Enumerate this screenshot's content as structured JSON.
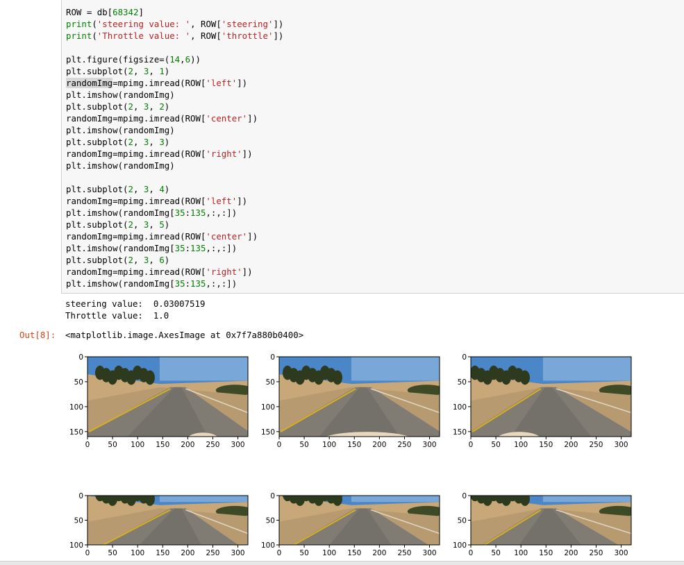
{
  "code_lines": [
    [
      {
        "t": "ROW = db["
      },
      {
        "t": "68342",
        "c": "num"
      },
      {
        "t": "]"
      }
    ],
    [
      {
        "t": "print",
        "c": "kw"
      },
      {
        "t": "("
      },
      {
        "t": "'steering value: '",
        "c": "str"
      },
      {
        "t": ", ROW["
      },
      {
        "t": "'steering'",
        "c": "str"
      },
      {
        "t": "])"
      }
    ],
    [
      {
        "t": "print",
        "c": "kw"
      },
      {
        "t": "("
      },
      {
        "t": "'Throttle value: '",
        "c": "str"
      },
      {
        "t": ", ROW["
      },
      {
        "t": "'throttle'",
        "c": "str"
      },
      {
        "t": "])"
      }
    ],
    [],
    [
      {
        "t": "plt.figure(figsize=("
      },
      {
        "t": "14",
        "c": "num"
      },
      {
        "t": ","
      },
      {
        "t": "6",
        "c": "num"
      },
      {
        "t": "))"
      }
    ],
    [
      {
        "t": "plt.subplot("
      },
      {
        "t": "2",
        "c": "num"
      },
      {
        "t": ", "
      },
      {
        "t": "3",
        "c": "num"
      },
      {
        "t": ", "
      },
      {
        "t": "1",
        "c": "num"
      },
      {
        "t": ")"
      }
    ],
    [
      {
        "t": "randomImg",
        "c": "hl"
      },
      {
        "t": "=mpimg.imread(ROW["
      },
      {
        "t": "'left'",
        "c": "str"
      },
      {
        "t": "])"
      }
    ],
    [
      {
        "t": "plt.imshow(randomImg)"
      }
    ],
    [
      {
        "t": "plt.subplot("
      },
      {
        "t": "2",
        "c": "num"
      },
      {
        "t": ", "
      },
      {
        "t": "3",
        "c": "num"
      },
      {
        "t": ", "
      },
      {
        "t": "2",
        "c": "num"
      },
      {
        "t": ")"
      }
    ],
    [
      {
        "t": "randomImg=mpimg.imread(ROW["
      },
      {
        "t": "'center'",
        "c": "str"
      },
      {
        "t": "])"
      }
    ],
    [
      {
        "t": "plt.imshow(randomImg)"
      }
    ],
    [
      {
        "t": "plt.subplot("
      },
      {
        "t": "2",
        "c": "num"
      },
      {
        "t": ", "
      },
      {
        "t": "3",
        "c": "num"
      },
      {
        "t": ", "
      },
      {
        "t": "3",
        "c": "num"
      },
      {
        "t": ")"
      }
    ],
    [
      {
        "t": "randomImg=mpimg.imread(ROW["
      },
      {
        "t": "'right'",
        "c": "str"
      },
      {
        "t": "])"
      }
    ],
    [
      {
        "t": "plt.imshow(randomImg)"
      }
    ],
    [],
    [
      {
        "t": "plt.subplot("
      },
      {
        "t": "2",
        "c": "num"
      },
      {
        "t": ", "
      },
      {
        "t": "3",
        "c": "num"
      },
      {
        "t": ", "
      },
      {
        "t": "4",
        "c": "num"
      },
      {
        "t": ")"
      }
    ],
    [
      {
        "t": "randomImg=mpimg.imread(ROW["
      },
      {
        "t": "'left'",
        "c": "str"
      },
      {
        "t": "])"
      }
    ],
    [
      {
        "t": "plt.imshow(randomImg["
      },
      {
        "t": "35",
        "c": "num"
      },
      {
        "t": ":"
      },
      {
        "t": "135",
        "c": "num"
      },
      {
        "t": ",:,:])"
      }
    ],
    [
      {
        "t": "plt.subplot("
      },
      {
        "t": "2",
        "c": "num"
      },
      {
        "t": ", "
      },
      {
        "t": "3",
        "c": "num"
      },
      {
        "t": ", "
      },
      {
        "t": "5",
        "c": "num"
      },
      {
        "t": ")"
      }
    ],
    [
      {
        "t": "randomImg=mpimg.imread(ROW["
      },
      {
        "t": "'center'",
        "c": "str"
      },
      {
        "t": "])"
      }
    ],
    [
      {
        "t": "plt.imshow(randomImg["
      },
      {
        "t": "35",
        "c": "num"
      },
      {
        "t": ":"
      },
      {
        "t": "135",
        "c": "num"
      },
      {
        "t": ",:,:])"
      }
    ],
    [
      {
        "t": "plt.subplot("
      },
      {
        "t": "2",
        "c": "num"
      },
      {
        "t": ", "
      },
      {
        "t": "3",
        "c": "num"
      },
      {
        "t": ", "
      },
      {
        "t": "6",
        "c": "num"
      },
      {
        "t": ")"
      }
    ],
    [
      {
        "t": "randomImg=mpimg.imread(ROW["
      },
      {
        "t": "'right'",
        "c": "str"
      },
      {
        "t": "])"
      }
    ],
    [
      {
        "t": "plt.imshow(randomImg["
      },
      {
        "t": "35",
        "c": "num"
      },
      {
        "t": ":"
      },
      {
        "t": "135",
        "c": "num"
      },
      {
        "t": ",:,:])"
      }
    ]
  ],
  "stdout": {
    "line1": "steering value:  0.03007519",
    "line2": "Throttle value:  1.0"
  },
  "output": {
    "prompt": "Out[8]:",
    "repr": "<matplotlib.image.AxesImage at 0x7f7a880b0400>"
  },
  "chart_data": [
    {
      "type": "image",
      "subplot": 1,
      "camera": "left",
      "crop": false,
      "xticks": [
        "0",
        "50",
        "100",
        "150",
        "200",
        "250",
        "300"
      ],
      "yticks": [
        "0",
        "50",
        "100",
        "150"
      ],
      "xlim": [
        0,
        320
      ],
      "ylim": [
        160,
        0
      ]
    },
    {
      "type": "image",
      "subplot": 2,
      "camera": "center",
      "crop": false,
      "xticks": [
        "0",
        "50",
        "100",
        "150",
        "200",
        "250",
        "300"
      ],
      "yticks": [
        "0",
        "50",
        "100",
        "150"
      ],
      "xlim": [
        0,
        320
      ],
      "ylim": [
        160,
        0
      ]
    },
    {
      "type": "image",
      "subplot": 3,
      "camera": "right",
      "crop": false,
      "xticks": [
        "0",
        "50",
        "100",
        "150",
        "200",
        "250",
        "300"
      ],
      "yticks": [
        "0",
        "50",
        "100",
        "150"
      ],
      "xlim": [
        0,
        320
      ],
      "ylim": [
        160,
        0
      ]
    },
    {
      "type": "image",
      "subplot": 4,
      "camera": "left",
      "crop": true,
      "xticks": [
        "0",
        "50",
        "100",
        "150",
        "200",
        "250",
        "300"
      ],
      "yticks": [
        "0",
        "50",
        "100"
      ],
      "xlim": [
        0,
        320
      ],
      "ylim": [
        100,
        0
      ]
    },
    {
      "type": "image",
      "subplot": 5,
      "camera": "center",
      "crop": true,
      "xticks": [
        "0",
        "50",
        "100",
        "150",
        "200",
        "250",
        "300"
      ],
      "yticks": [
        "0",
        "50",
        "100"
      ],
      "xlim": [
        0,
        320
      ],
      "ylim": [
        100,
        0
      ]
    },
    {
      "type": "image",
      "subplot": 6,
      "camera": "right",
      "crop": true,
      "xticks": [
        "0",
        "50",
        "100",
        "150",
        "200",
        "250",
        "300"
      ],
      "yticks": [
        "0",
        "50",
        "100"
      ],
      "xlim": [
        0,
        320
      ],
      "ylim": [
        100,
        0
      ]
    }
  ],
  "colors": {
    "sky": "#4a86c8",
    "sky_light": "#a8c8e6",
    "trees": "#2d3a1e",
    "hills": "#c8a878",
    "dirt": "#b89a70",
    "road": "#807c74",
    "road_dark": "#5e5c58",
    "lane": "#d8b020",
    "hood": "#e8d8c0",
    "prompt_out": "#d84315"
  }
}
